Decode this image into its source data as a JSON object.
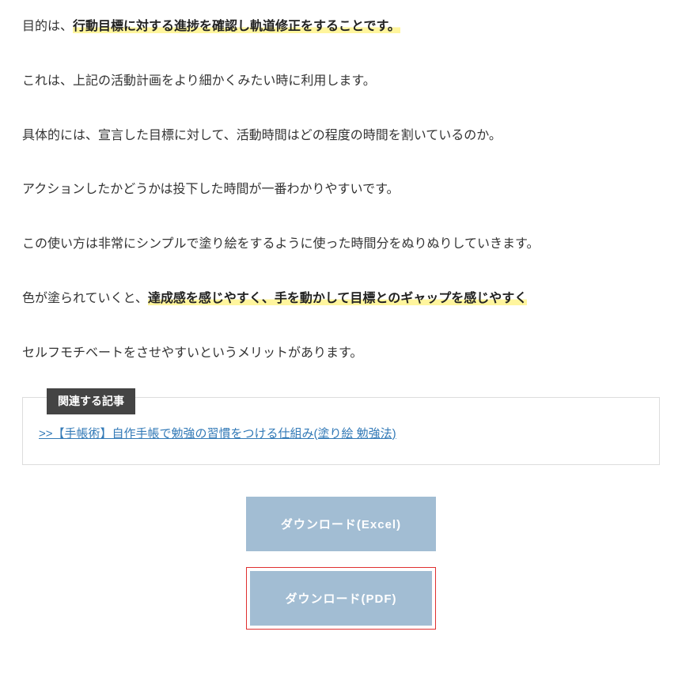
{
  "paragraphs": {
    "p1_pre": "目的は、",
    "p1_hl": "行動目標に対する進捗を確認し軌道修正をすることです。",
    "p2": "これは、上記の活動計画をより細かくみたい時に利用します。",
    "p3": "具体的には、宣言した目標に対して、活動時間はどの程度の時間を割いているのか。",
    "p4": "アクションしたかどうかは投下した時間が一番わかりやすいです。",
    "p5": "この使い方は非常にシンプルで塗り絵をするように使った時間分をぬりぬりしていきます。",
    "p6_pre": "色が塗られていくと、",
    "p6_hl": "達成感を感じやすく、手を動かして目標とのギャップを感じやすく",
    "p7": "セルフモチベートをさせやすいというメリットがあります。"
  },
  "related": {
    "title": "関連する記事",
    "link_text": ">>【手帳術】自作手帳で勉強の習慣をつける仕組み(塗り絵 勉強法)"
  },
  "buttons": {
    "excel": "ダウンロード(Excel)",
    "pdf": "ダウンロード(PDF)"
  }
}
